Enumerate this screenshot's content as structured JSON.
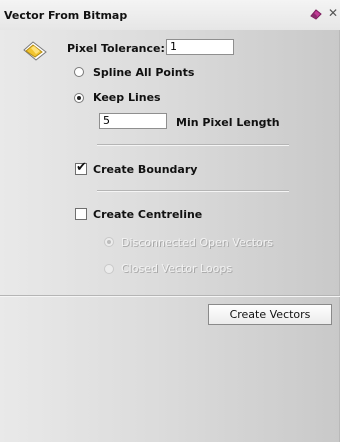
{
  "window": {
    "title": "Vector From Bitmap",
    "title_icon": "eraser-icon",
    "close_icon": "close-icon"
  },
  "tool": {
    "icon": "bitmap-to-vector-icon"
  },
  "pixel_tolerance": {
    "label": "Pixel Tolerance:",
    "value": "1"
  },
  "options": {
    "spline_all_points": {
      "label": "Spline All Points",
      "selected": false
    },
    "keep_lines": {
      "label": "Keep Lines",
      "selected": true
    },
    "min_pixel_length": {
      "label": "Min Pixel Length",
      "value": "5"
    }
  },
  "create_boundary": {
    "label": "Create Boundary",
    "checked": true
  },
  "create_centreline": {
    "label": "Create Centreline",
    "checked": false
  },
  "centreline_options": {
    "disconnected_open_vectors": {
      "label": "Disconnected Open Vectors",
      "selected": true,
      "enabled": false
    },
    "closed_vector_loops": {
      "label": "Closed Vector Loops",
      "selected": false,
      "enabled": false
    }
  },
  "actions": {
    "create_vectors": "Create Vectors"
  },
  "colors": {
    "accent_icon": "#c23a96",
    "icon_yellow": "#f2c531",
    "panel_bg": "#dcdcdc"
  }
}
